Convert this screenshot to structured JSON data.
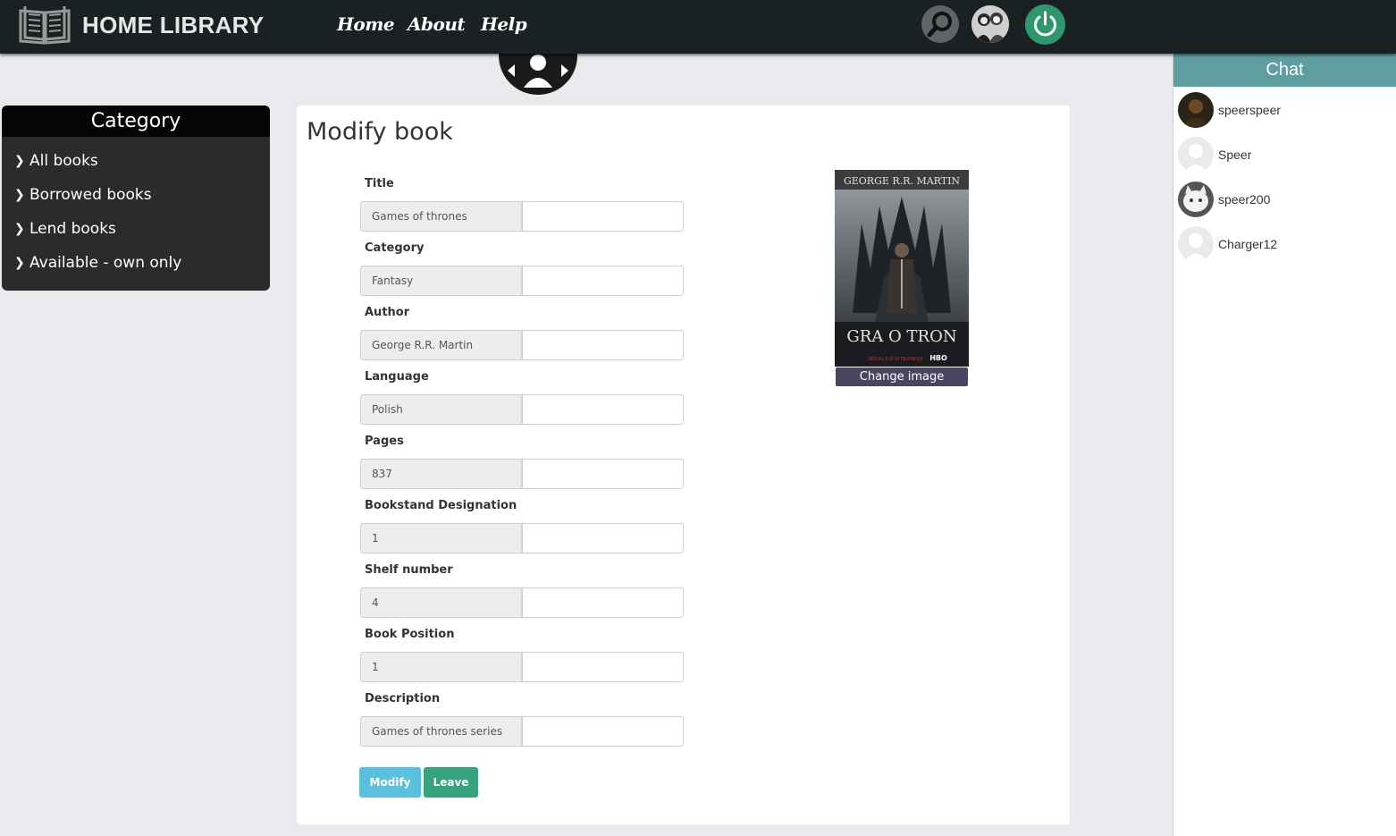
{
  "header": {
    "brand": "HOME LIBRARY",
    "nav": [
      "Home",
      "About",
      "Help"
    ],
    "icons": [
      "book-logo-icon",
      "search-icon",
      "friends-icon",
      "power-icon"
    ],
    "colors": {
      "bar": "#1a2122",
      "power": "#2f9770"
    }
  },
  "sidebar": {
    "title": "Category",
    "items": [
      "All books",
      "Borrowed books",
      "Lend books",
      "Available - own only"
    ]
  },
  "form": {
    "title": "Modify book",
    "fields": [
      {
        "label": "Title",
        "current": "Games of thrones",
        "value": ""
      },
      {
        "label": "Category",
        "current": "Fantasy",
        "value": ""
      },
      {
        "label": "Author",
        "current": "George R.R. Martin",
        "value": ""
      },
      {
        "label": "Language",
        "current": "Polish",
        "value": ""
      },
      {
        "label": "Pages",
        "current": "837",
        "value": ""
      },
      {
        "label": "Bookstand Designation",
        "current": "1",
        "value": ""
      },
      {
        "label": "Shelf number",
        "current": "4",
        "value": ""
      },
      {
        "label": "Book Position",
        "current": "1",
        "value": ""
      },
      {
        "label": "Description",
        "current": "Games of thrones series",
        "value": ""
      }
    ],
    "buttons": {
      "modify": "Modify",
      "leave": "Leave"
    },
    "cover": {
      "author": "GEORGE R.R. MARTIN",
      "title": "GRA O TRON",
      "tagline": "SERIAL JUŻ W TELEWIZJI",
      "network": "HBO"
    },
    "change_image": "Change image"
  },
  "chat": {
    "title": "Chat",
    "users": [
      "speerspeer",
      "Speer",
      "speer200",
      "Charger12"
    ],
    "accent": "#5f9ea0"
  }
}
